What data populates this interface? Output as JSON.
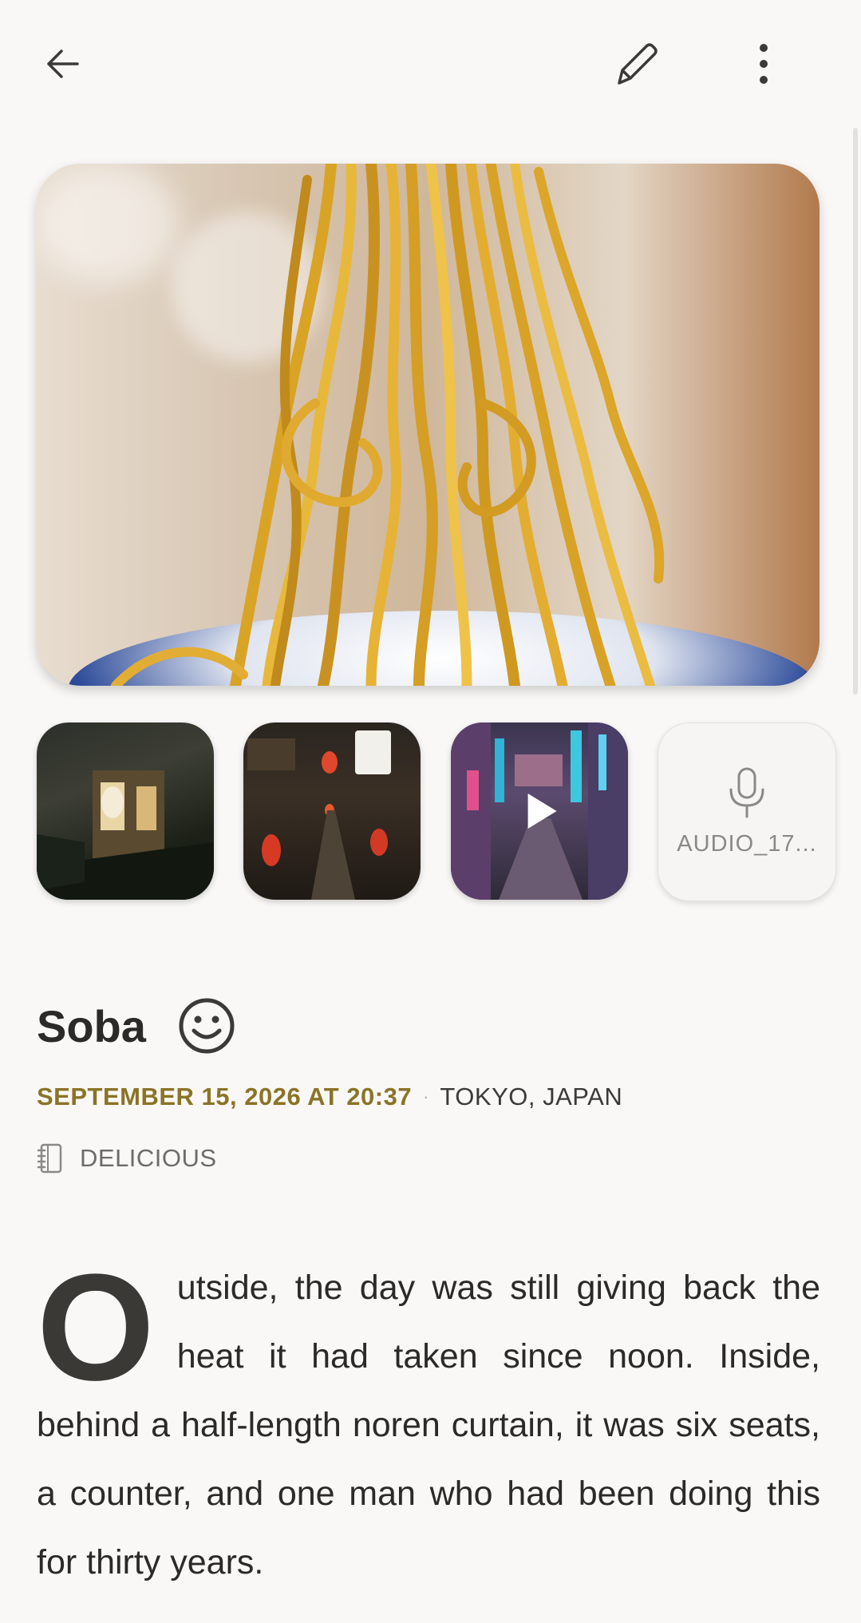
{
  "toolbar": {
    "back_icon": "arrow-left-icon",
    "edit_icon": "pencil-icon",
    "more_icon": "more-vertical-icon"
  },
  "media": {
    "hero": "Noodles lifted from a blue bowl",
    "thumbnails": [
      {
        "kind": "image",
        "subject": "Night alley shopfront with lanterns"
      },
      {
        "kind": "image",
        "subject": "Narrow alley with red lanterns"
      },
      {
        "kind": "video",
        "subject": "Neon-lit street at night",
        "overlay_icon": "play-icon"
      },
      {
        "kind": "audio",
        "label": "AUDIO_17...",
        "icon": "microphone-icon"
      }
    ]
  },
  "entry": {
    "title": "Soba",
    "mood_icon": "smiley-face-icon",
    "date": "SEPTEMBER 15, 2026 AT 20:37",
    "separator": "·",
    "location": "TOKYO, JAPAN",
    "journal_icon": "notebook-icon",
    "journal": "DELICIOUS",
    "drop_cap": "O",
    "body": "utside, the day was still giving back the heat it had taken since noon. Inside, behind a half-length noren curtain, it was six seats, a counter, and one man who had been doing this for thirty years."
  },
  "colors": {
    "background": "#f9f8f7",
    "date_accent": "#8a7426",
    "text": "#2b2a28"
  }
}
